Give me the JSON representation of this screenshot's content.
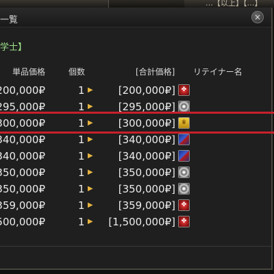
{
  "window": {
    "title": "一覧",
    "top_title_fragment": "…【以上】【…】",
    "category": "学士】",
    "close_symbol": "×"
  },
  "columns": {
    "unit_price": "単品価格",
    "quantity": "個数",
    "total_price": "[合計価格]",
    "retainer_name": "リテイナー名"
  },
  "listings": [
    {
      "price": "200,000₽",
      "qty": "1",
      "total": "[200,000₽]",
      "retainer_icon": "red-crest-icon"
    },
    {
      "price": "295,000₽",
      "qty": "1",
      "total": "[295,000₽]",
      "retainer_icon": "swirl-crest-icon"
    },
    {
      "price": "300,000₽",
      "qty": "1",
      "total": "[300,000₽]",
      "retainer_icon": "gold-crest-icon"
    },
    {
      "price": "340,000₽",
      "qty": "1",
      "total": "[340,000₽]",
      "retainer_icon": "blue-crest-icon"
    },
    {
      "price": "340,000₽",
      "qty": "1",
      "total": "[340,000₽]",
      "retainer_icon": "blue-crest-icon"
    },
    {
      "price": "350,000₽",
      "qty": "1",
      "total": "[350,000₽]",
      "retainer_icon": "swirl-crest-icon"
    },
    {
      "price": "350,000₽",
      "qty": "1",
      "total": "[350,000₽]",
      "retainer_icon": "swirl-crest-icon"
    },
    {
      "price": "359,000₽",
      "qty": "1",
      "total": "[359,000₽]",
      "retainer_icon": "red-crest-icon"
    },
    {
      "price": "500,000₽",
      "qty": "1",
      "total": "[1,500,000₽]",
      "retainer_icon": "red-crest-icon"
    }
  ],
  "highlighted_row_index": 2,
  "colors": {
    "highlight_line": "#c8202a",
    "category_text": "#9ee28a",
    "arrow": "#e6b440"
  }
}
